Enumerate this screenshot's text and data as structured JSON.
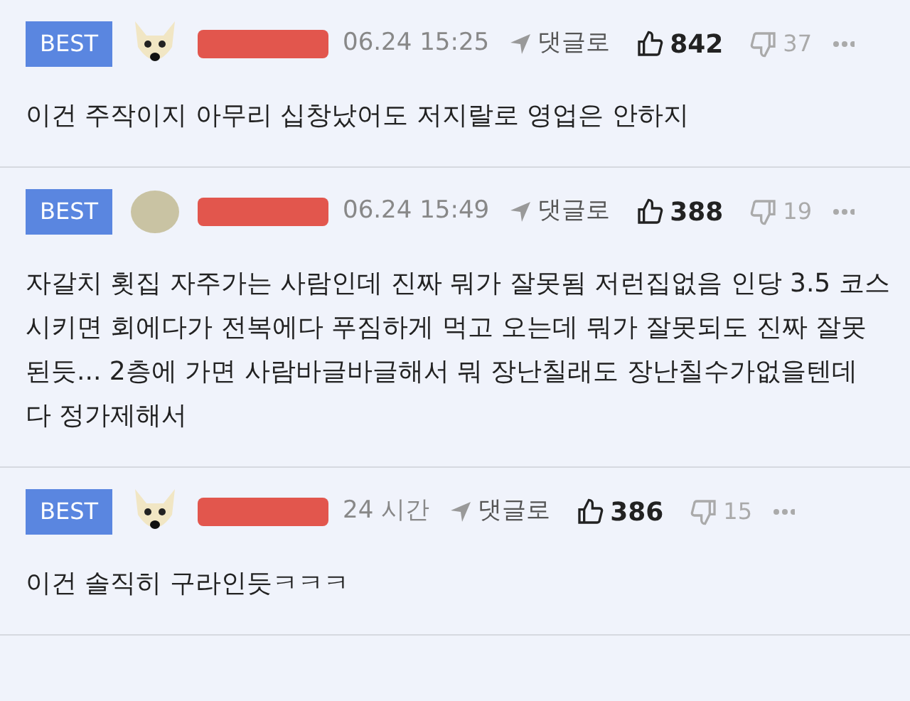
{
  "comments": [
    {
      "badge": "BEST",
      "avatar": {
        "kind": "dog"
      },
      "time": "06.24 15:25",
      "reply": "댓글로",
      "likes": "842",
      "dislikes": "37",
      "text": "이건 주작이지 아무리 십창났어도 저지랄로 영업은 안하지"
    },
    {
      "badge": "BEST",
      "avatar": {
        "kind": "blob"
      },
      "time": "06.24 15:49",
      "reply": "댓글로",
      "likes": "388",
      "dislikes": "19",
      "text": "자갈치 횟집 자주가는 사람인데 진짜 뭐가 잘못됨 저런집없음 인당 3.5 코스시키면 회에다가 전복에다 푸짐하게 먹고 오는데 뭐가 잘못되도 진짜 잘못된듯... 2층에 가면 사람바글바글해서 뭐 장난칠래도 장난칠수가없을텐데 다 정가제해서"
    },
    {
      "badge": "BEST",
      "avatar": {
        "kind": "dog"
      },
      "time": "24 시간",
      "reply": "댓글로",
      "likes": "386",
      "dislikes": "15",
      "text": "이건 솔직히 구라인듯ㅋㅋㅋ"
    }
  ]
}
